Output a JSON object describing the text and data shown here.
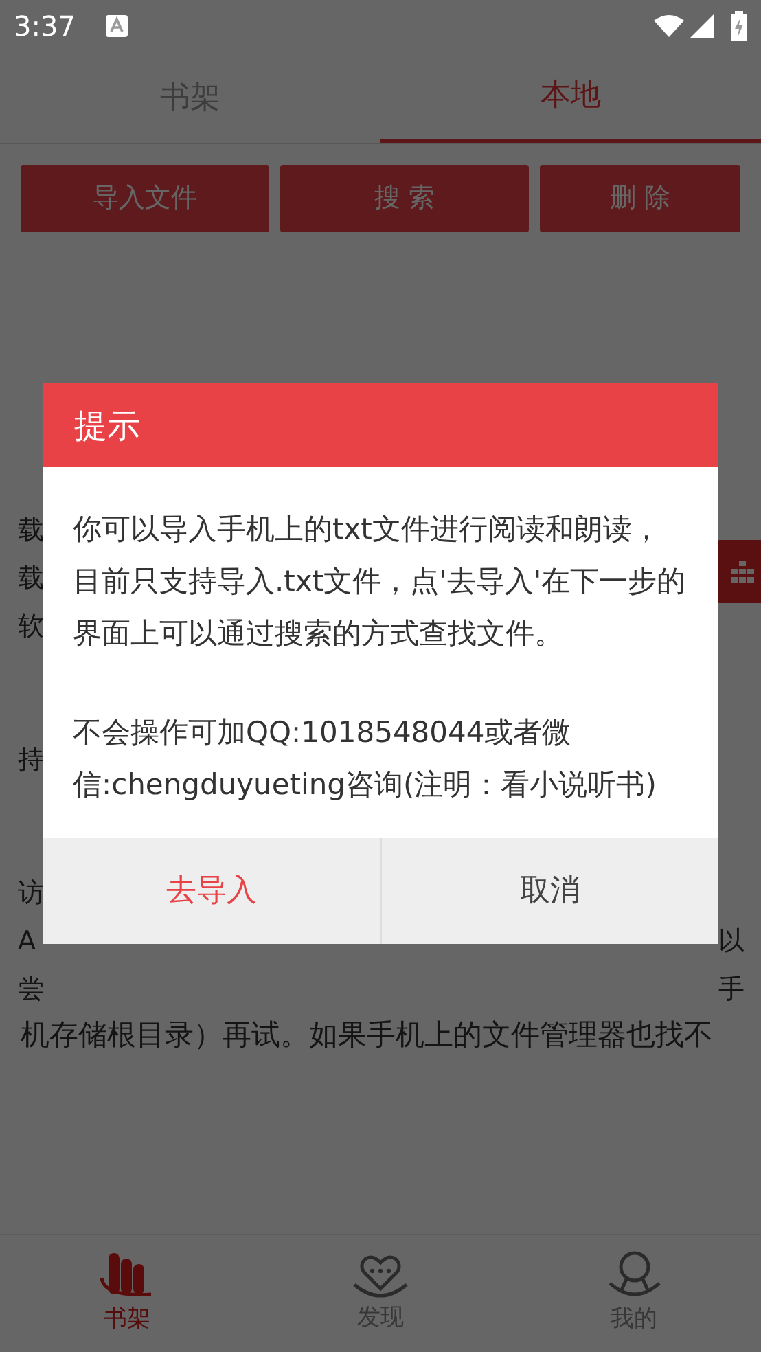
{
  "status_bar": {
    "time": "3:37"
  },
  "tabs": [
    {
      "label": "书架",
      "selected": false
    },
    {
      "label": "本地",
      "selected": true
    }
  ],
  "actions": [
    "导入文件",
    "搜 索",
    "删 除"
  ],
  "background_text": {
    "paragraphs": [
      [
        {
          "left": "载"
        },
        {
          "left": "载"
        },
        {
          "left": "软"
        }
      ],
      [
        {
          "left": "持"
        }
      ],
      [
        {
          "left": "访"
        },
        {
          "left": "A",
          "right": "以"
        },
        {
          "left": "尝",
          "right": "手"
        }
      ]
    ],
    "last_line": "机存储根目录）再试。如果手机上的文件管理器也找不"
  },
  "dialog": {
    "title": "提示",
    "paragraphs": [
      "你可以导入手机上的txt文件进行阅读和朗读，目前只支持导入.txt文件，点'去导入'在下一步的界面上可以通过搜索的方式查找文件。",
      "不会操作可加QQ:1018548044或者微信:chengduyueting咨询(注明：看小说听书)"
    ],
    "buttons": [
      {
        "label": "去导入",
        "kind": "confirm"
      },
      {
        "label": "取消",
        "kind": "cancel"
      }
    ]
  },
  "bottom_nav": [
    {
      "label": "书架",
      "selected": true
    },
    {
      "label": "发现",
      "selected": false
    },
    {
      "label": "我的",
      "selected": false
    }
  ]
}
